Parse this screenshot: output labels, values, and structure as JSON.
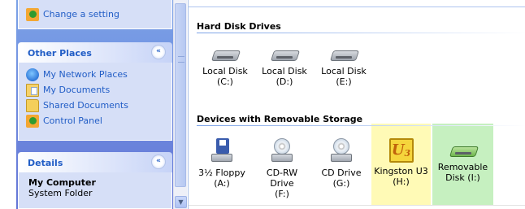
{
  "task_pane": {
    "system_tasks": {
      "change_setting": "Change a setting"
    },
    "other_places": {
      "title": "Other Places",
      "collapse_glyph": "«",
      "links": [
        {
          "label": "My Network Places",
          "icon": "network-places-icon"
        },
        {
          "label": "My Documents",
          "icon": "my-documents-icon"
        },
        {
          "label": "Shared Documents",
          "icon": "shared-documents-icon"
        },
        {
          "label": "Control Panel",
          "icon": "control-panel-icon"
        }
      ]
    },
    "details": {
      "title": "Details",
      "collapse_glyph": "«",
      "name": "My Computer",
      "type": "System Folder"
    },
    "scroll_arrow": "▼"
  },
  "content": {
    "hard_disk_group": {
      "title": "Hard Disk Drives",
      "drives": [
        {
          "label": "Local Disk (C:)"
        },
        {
          "label": "Local Disk (D:)"
        },
        {
          "label": "Local Disk (E:)"
        }
      ]
    },
    "removable_group": {
      "title": "Devices with Removable Storage",
      "devices": [
        {
          "line1": "3½ Floppy",
          "line2": "(A:)",
          "icon": "floppy-drive-icon"
        },
        {
          "line1": "CD-RW Drive",
          "line2": "(F:)",
          "icon": "cd-drive-icon"
        },
        {
          "line1": "CD Drive (G:)",
          "line2": "",
          "icon": "cd-drive-icon"
        },
        {
          "line1": "Kingston U3",
          "line2": "(H:)",
          "icon": "u3-drive-icon",
          "highlight": "#fffab6"
        },
        {
          "line1": "Removable",
          "line2": "Disk (I:)",
          "icon": "removable-disk-icon",
          "highlight": "#c6f0c0"
        }
      ]
    }
  },
  "colors": {
    "link_blue": "#215dc6",
    "pane_gradient_top": "#7ba2e7",
    "pane_gradient_bottom": "#6375d6",
    "box_bg": "#d6dff7"
  }
}
